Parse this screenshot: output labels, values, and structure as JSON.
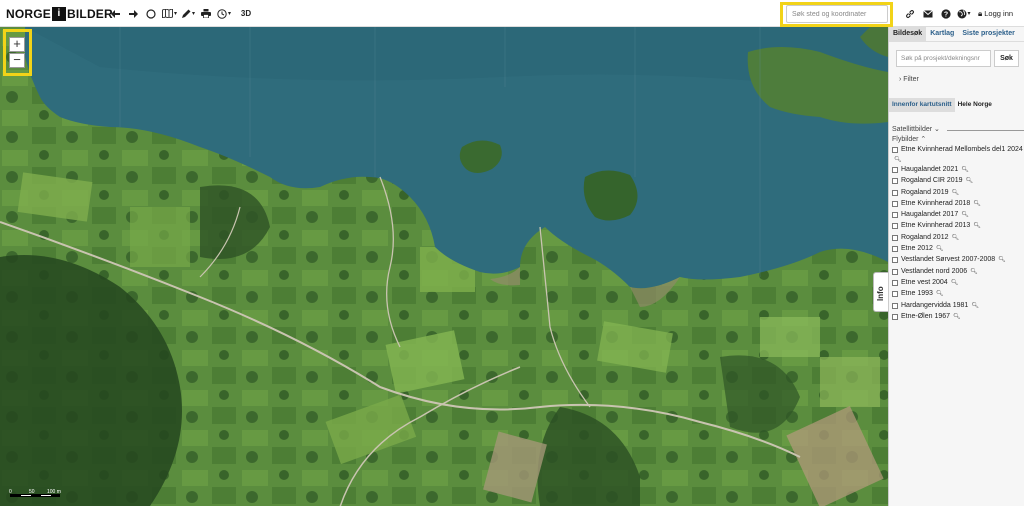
{
  "app": {
    "logo_left": "NORGE",
    "logo_mid": "i",
    "logo_right": "BILDER"
  },
  "toolbar": {
    "tools": [
      {
        "name": "back-arrow-icon",
        "glyph": "←"
      },
      {
        "name": "forward-arrow-icon",
        "glyph": "→"
      },
      {
        "name": "circle-select-icon",
        "glyph": "◯"
      },
      {
        "name": "map-icon",
        "glyph": "▥"
      },
      {
        "name": "pen-icon",
        "glyph": "✎"
      },
      {
        "name": "print-icon",
        "glyph": "⎙"
      },
      {
        "name": "clock-icon",
        "glyph": "◷"
      }
    ],
    "three_d_label": "3D",
    "login_label": "Logg inn"
  },
  "search": {
    "placeholder": "Søk sted og koordinater"
  },
  "map": {
    "info_label": "Info",
    "scale_labels": [
      "0",
      "50",
      "100 m"
    ],
    "water_color": "#2f6c7c",
    "land_color": "#4e7d39"
  },
  "panel": {
    "tabs": [
      {
        "label": "Bildesøk",
        "active": true
      },
      {
        "label": "Kartlag",
        "active": false
      },
      {
        "label": "Siste prosjekter",
        "active": false
      }
    ],
    "search_placeholder": "Søk på prosjekt/dekningsnr",
    "search_button": "Søk",
    "filter_label": "Filter",
    "scope_tabs": [
      {
        "label": "Innenfor kartutsnitt",
        "active": true
      },
      {
        "label": "Hele Norge",
        "active": false
      }
    ],
    "section_satellite": "Satellittbilder",
    "section_aerial": "Flybilder",
    "projects": [
      "Etne Kvinnherad Mellombels del1 2024",
      "Haugalandet 2021",
      "Rogaland CIR 2019",
      "Rogaland 2019",
      "Etne Kvinnherad 2018",
      "Haugalandet 2017",
      "Etne Kvinnherad 2013",
      "Rogaland 2012",
      "Etne 2012",
      "Vestlandet Sørvest 2007-2008",
      "Vestlandet nord 2006",
      "Etne vest 2004",
      "Etne 1993",
      "Hardangervidda 1981",
      "Etne-Ølen 1967"
    ]
  }
}
